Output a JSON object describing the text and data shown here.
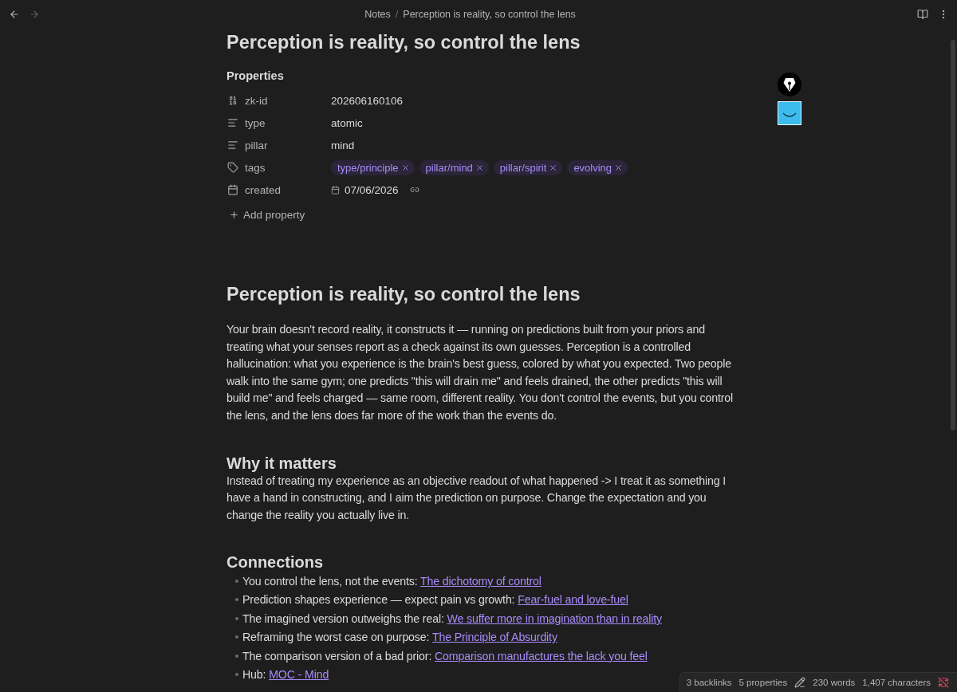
{
  "nav": [
    {
      "kind": "back",
      "disabled": false
    },
    {
      "kind": "forward",
      "disabled": true
    }
  ],
  "breadcrumb": {
    "items": [
      "Notes",
      "Perception is reality, so control the lens"
    ],
    "separator": "/"
  },
  "title": "Perception is reality, so control the lens",
  "properties": {
    "heading": "Properties",
    "items": [
      {
        "kind": "number",
        "label": "zk-id",
        "value": "202606160106"
      },
      {
        "kind": "text",
        "label": "type",
        "value": "atomic"
      },
      {
        "kind": "text",
        "label": "pillar",
        "value": "mind"
      },
      {
        "kind": "tags",
        "label": "tags",
        "tags": [
          "type/principle",
          "pillar/mind",
          "pillar/spirit",
          "evolving"
        ]
      },
      {
        "kind": "date",
        "label": "created",
        "value": "07/06/2026"
      }
    ],
    "add_label": "Add property"
  },
  "heading": "Perception is reality, so control the lens",
  "paragraph": "Your brain doesn't record reality, it constructs it — running on predictions built from your priors and treating what your senses report as a check against its own guesses. Perception is a controlled hallucination: what you experience is the brain's best guess, colored by what you expected. Two people walk into the same gym; one predicts \"this will drain me\" and feels drained, the other predicts \"this will build me\" and feels charged — same room, different reality. You don't control the events, but you control the lens, and the lens does far more of the work than the events do.",
  "sections": [
    {
      "kind": "text",
      "heading": "Why it matters",
      "paragraph": "Instead of treating my experience as an objective readout of what happened -> I treat it as something I have a hand in constructing, and I aim the prediction on purpose. Change the expectation and you change the reality you actually live in."
    },
    {
      "kind": "list",
      "heading": "Connections",
      "items": [
        {
          "text": "You control the lens, not the events:",
          "link": "The dichotomy of control"
        },
        {
          "text": "Prediction shapes experience — expect pain vs growth:",
          "link": "Fear-fuel and love-fuel"
        },
        {
          "text": "The imagined version outweighs the real:",
          "link": "We suffer more in imagination than in reality"
        },
        {
          "text": "Reframing the worst case on purpose:",
          "link": "The Principle of Absurdity"
        },
        {
          "text": "The comparison version of a bad prior:",
          "link": "Comparison manufactures the lack you feel"
        },
        {
          "text": "Hub:",
          "link": "MOC - Mind"
        }
      ]
    }
  ],
  "status_bar": {
    "backlinks": "3 backlinks",
    "properties": "5 properties",
    "words": "230 words",
    "characters": "1,407 characters"
  }
}
